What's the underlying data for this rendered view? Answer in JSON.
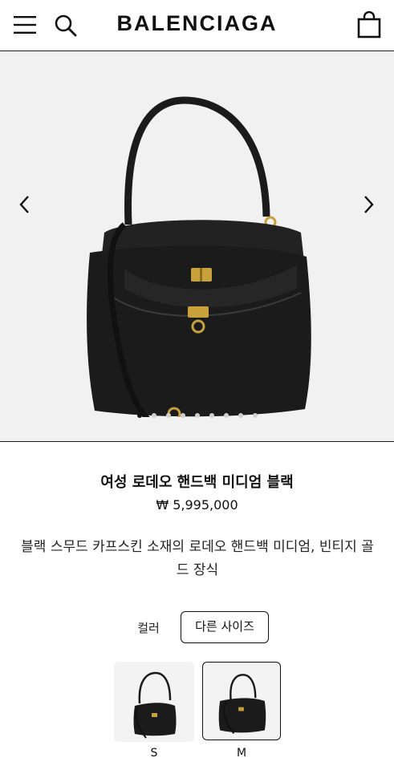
{
  "header": {
    "brand": "BALENCIAGA",
    "menu_icon": "hamburger-menu-icon",
    "search_icon": "search-icon",
    "bag_icon": "shopping-bag-icon"
  },
  "gallery": {
    "image_count": 9,
    "active_index": 0,
    "prev_icon": "chevron-left-icon",
    "next_icon": "chevron-right-icon"
  },
  "product": {
    "title": "여성 로데오 핸드백 미디엄 블랙",
    "price": "₩ 5,995,000",
    "description": "블랙 스무드 카프스킨 소재의 로데오 핸드백 미디엄, 빈티지 골드 장식"
  },
  "options": {
    "color_label": "컬러",
    "size_button": "다른 사이즈",
    "variants": [
      {
        "label": "S",
        "selected": false
      },
      {
        "label": "M",
        "selected": true
      }
    ]
  },
  "colors": {
    "text": "#111111",
    "gallery_bg": "#f1f1f1",
    "bag": "#1b1b1b",
    "hardware_gold": "#c9a13b"
  }
}
